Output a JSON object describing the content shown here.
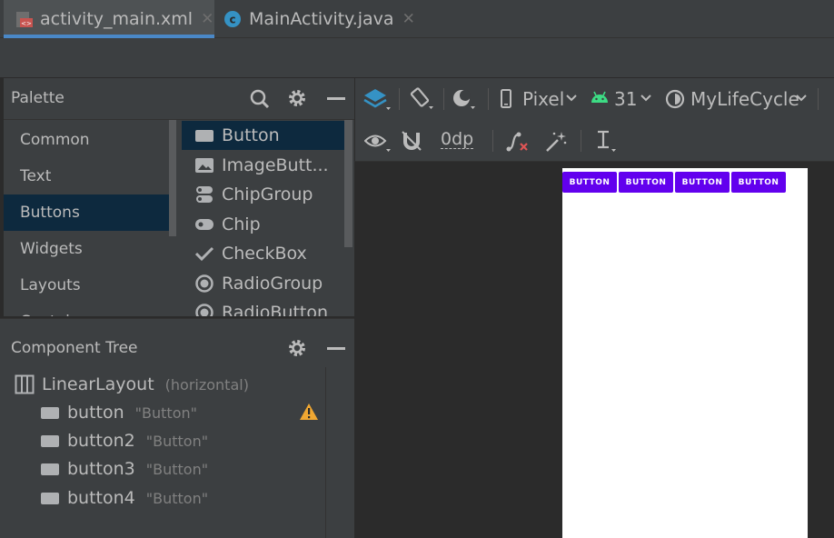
{
  "tabs": [
    {
      "label": "activity_main.xml",
      "icon": "xml-layout-icon",
      "active": true
    },
    {
      "label": "MainActivity.java",
      "icon": "java-class-icon",
      "active": false
    }
  ],
  "palette": {
    "title": "Palette",
    "categories": [
      "Common",
      "Text",
      "Buttons",
      "Widgets",
      "Layouts",
      "Contai..."
    ],
    "selected_category": "Buttons",
    "items": [
      {
        "label": "Button",
        "icon": "button-icon"
      },
      {
        "label": "ImageButt...",
        "icon": "image-button-icon"
      },
      {
        "label": "ChipGroup",
        "icon": "chip-group-icon"
      },
      {
        "label": "Chip",
        "icon": "chip-icon"
      },
      {
        "label": "CheckBox",
        "icon": "checkbox-icon"
      },
      {
        "label": "RadioGroup",
        "icon": "radio-group-icon"
      },
      {
        "label": "RadioButton",
        "icon": "radio-button-icon"
      }
    ]
  },
  "component_tree": {
    "title": "Component Tree",
    "root": {
      "label": "LinearLayout",
      "sub": "(horizontal)"
    },
    "children": [
      {
        "label": "button",
        "sub": "\"Button\"",
        "warning": true
      },
      {
        "label": "button2",
        "sub": "\"Button\"",
        "warning": false
      },
      {
        "label": "button3",
        "sub": "\"Button\"",
        "warning": false
      },
      {
        "label": "button4",
        "sub": "\"Button\"",
        "warning": false
      }
    ]
  },
  "toolbar": {
    "device": "Pixel",
    "api_level": "31",
    "theme": "MyLifeCycle",
    "default_margin": "0dp"
  },
  "preview": {
    "buttons": [
      "BUTTON",
      "BUTTON",
      "BUTTON",
      "BUTTON"
    ],
    "button_color": "#6200ee"
  },
  "colors": {
    "selection": "#0d293e",
    "tab_underline": "#4a88c7",
    "warning": "#f0a732",
    "android_green": "#3ddc84",
    "class_icon": "#3592c4"
  }
}
